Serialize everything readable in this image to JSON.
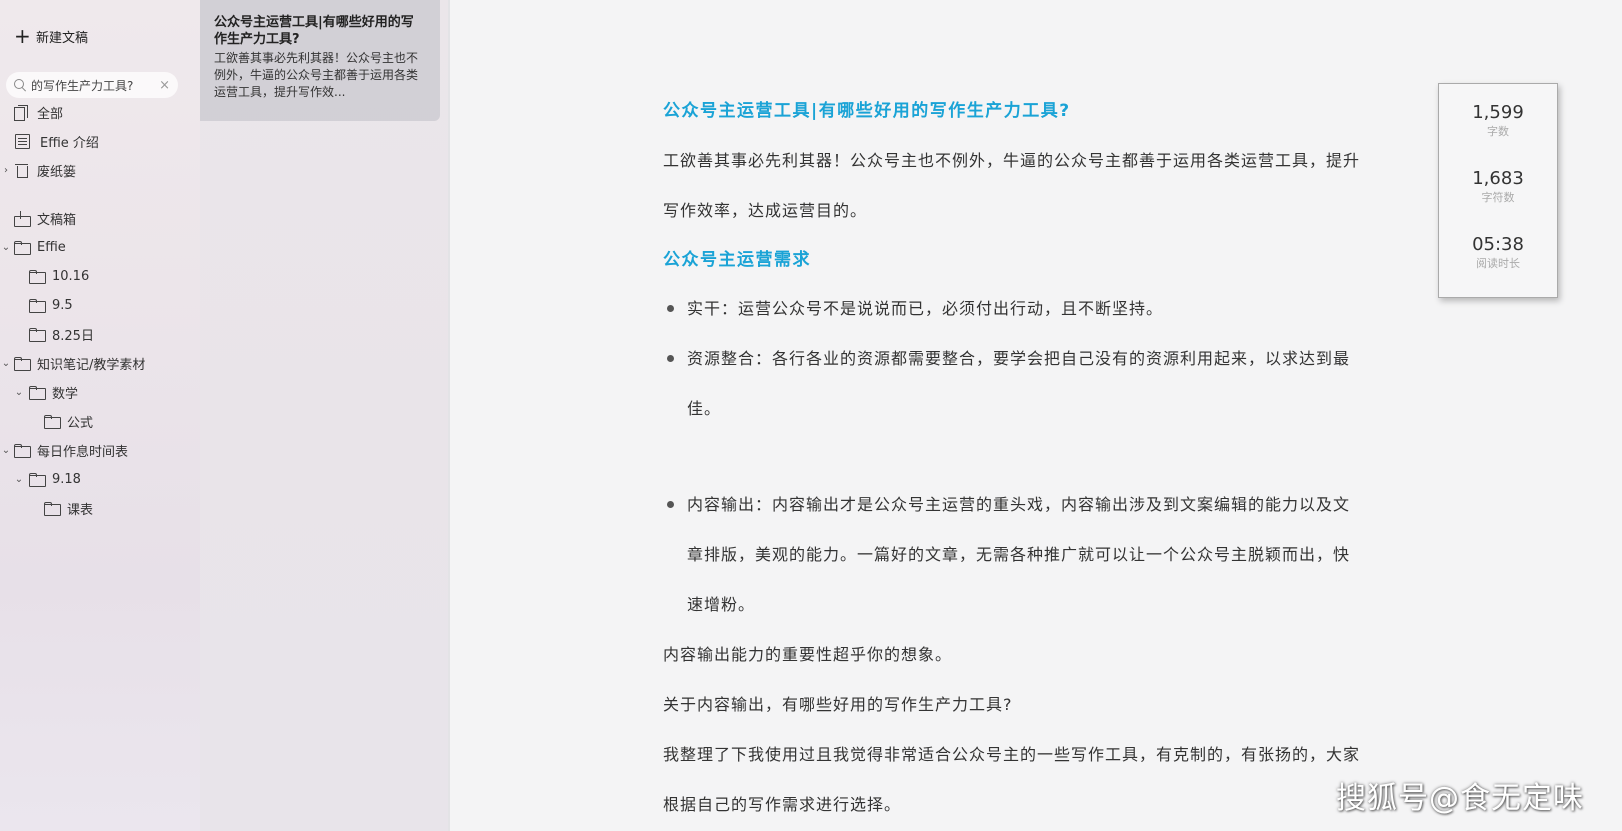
{
  "sidebar": {
    "new_doc_label": "新建文稿",
    "search": {
      "value": "的写作生产力工具?",
      "clear_glyph": "×"
    },
    "items": [
      {
        "label": "全部"
      },
      {
        "label": "Effie 介绍"
      },
      {
        "label": "废纸篓"
      },
      {
        "label": "文稿箱"
      },
      {
        "label": "Effie"
      },
      {
        "label": "10.16"
      },
      {
        "label": "9.5"
      },
      {
        "label": "8.25日"
      },
      {
        "label": "知识笔记/教学素材"
      },
      {
        "label": "数学"
      },
      {
        "label": "公式"
      },
      {
        "label": "每日作息时间表"
      },
      {
        "label": "9.18"
      },
      {
        "label": "课表"
      }
    ]
  },
  "doclist": {
    "card": {
      "title": "公众号主运营工具|有哪些好用的写作生产力工具?",
      "excerpt": "工欲善其事必先利其器！公众号主也不例外，牛逼的公众号主都善于运用各类运营工具，提升写作效..."
    }
  },
  "editor": {
    "title": "公众号主运营工具|有哪些好用的写作生产力工具?",
    "intro": "工欲善其事必先利其器！公众号主也不例外，牛逼的公众号主都善于运用各类运营工具，提升写作效率，达成运营目的。",
    "heading2": "公众号主运营需求",
    "bullets_a": [
      "实干：运营公众号不是说说而已，必须付出行动，且不断坚持。",
      "资源整合：各行各业的资源都需要整合，要学会把自己没有的资源利用起来，以求达到最佳。"
    ],
    "bullets_b": [
      "内容输出：内容输出才是公众号主运营的重头戏，内容输出涉及到文案编辑的能力以及文章排版，美观的能力。一篇好的文章，无需各种推广就可以让一个公众号主脱颖而出，快速增粉。"
    ],
    "p1": "内容输出能力的重要性超乎你的想象。",
    "p2": "关于内容输出，有哪些好用的写作生产力工具?",
    "p3": "我整理了下我使用过且我觉得非常适合公众号主的一些写作工具，有克制的，有张扬的，大家根据自己的写作需求进行选择。"
  },
  "stats": {
    "words": {
      "value": "1,599",
      "label": "字数"
    },
    "chars": {
      "value": "1,683",
      "label": "字符数"
    },
    "read_time": {
      "value": "05:38",
      "label": "阅读时长"
    }
  },
  "watermark": "搜狐号@食无定味"
}
